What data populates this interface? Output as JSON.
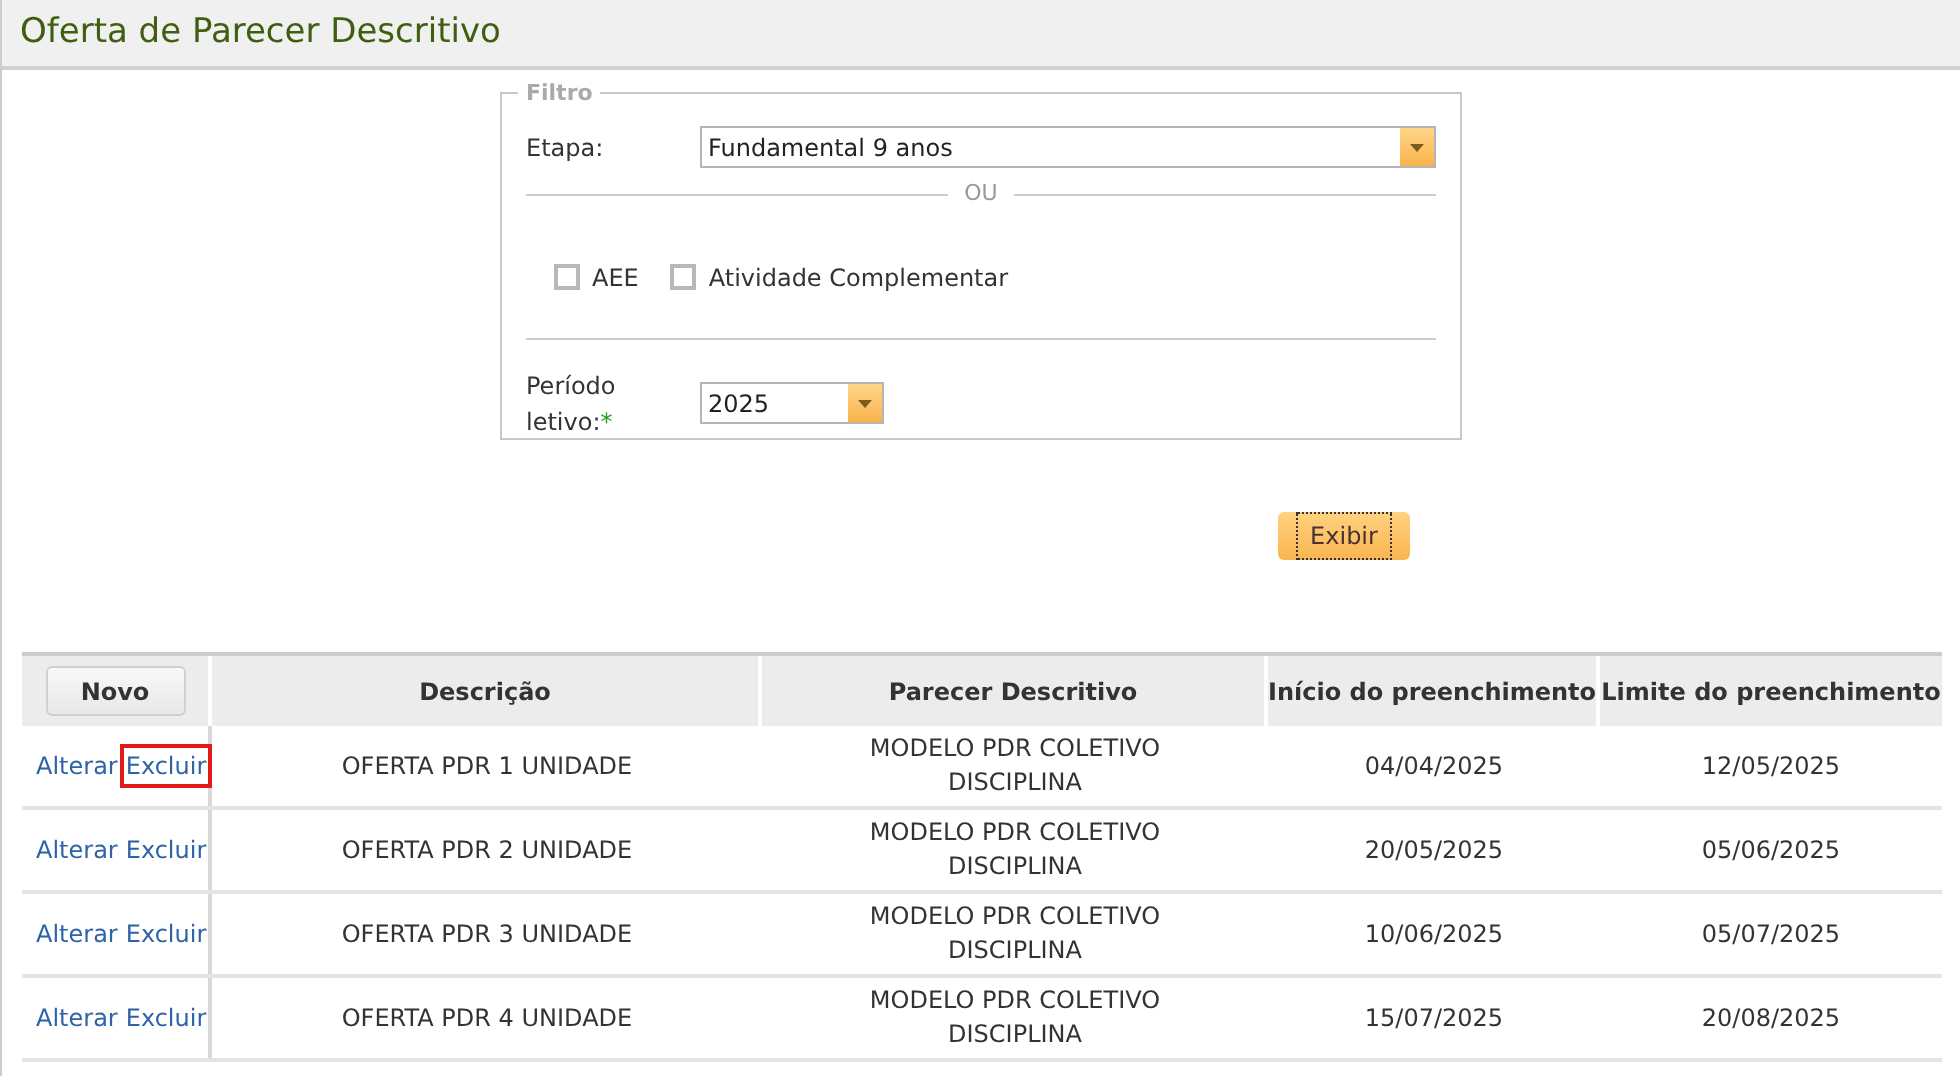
{
  "title": "Oferta de Parecer Descritivo",
  "filter": {
    "legend": "Filtro",
    "etapa_label": "Etapa:",
    "etapa_value": "Fundamental 9 anos",
    "separator": "OU",
    "checkboxes": [
      {
        "label": "AEE",
        "checked": false
      },
      {
        "label": "Atividade Complementar",
        "checked": false
      }
    ],
    "periodo_label": "Período letivo:",
    "required_mark": "*",
    "periodo_value": "2025"
  },
  "show_button": {
    "label": "Exibir",
    "focused": true
  },
  "table": {
    "new_button": "Novo",
    "columns": [
      "Descrição",
      "Parecer Descritivo",
      "Início do preenchimento",
      "Limite do preenchimento"
    ],
    "rows": [
      {
        "edit": "Alterar",
        "delete": "Excluir",
        "delete_highlighted": true,
        "cells": [
          "OFERTA PDR 1 UNIDADE",
          "MODELO PDR COLETIVO DISCIPLINA",
          "04/04/2025",
          "12/05/2025"
        ]
      },
      {
        "edit": "Alterar",
        "delete": "Excluir",
        "delete_highlighted": false,
        "cells": [
          "OFERTA PDR 2 UNIDADE",
          "MODELO PDR COLETIVO DISCIPLINA",
          "20/05/2025",
          "05/06/2025"
        ]
      },
      {
        "edit": "Alterar",
        "delete": "Excluir",
        "delete_highlighted": false,
        "cells": [
          "OFERTA PDR 3 UNIDADE",
          "MODELO PDR COLETIVO DISCIPLINA",
          "10/06/2025",
          "05/07/2025"
        ]
      },
      {
        "edit": "Alterar",
        "delete": "Excluir",
        "delete_highlighted": false,
        "cells": [
          "OFERTA PDR 4 UNIDADE",
          "MODELO PDR COLETIVO DISCIPLINA",
          "15/07/2025",
          "20/08/2025"
        ]
      }
    ]
  }
}
